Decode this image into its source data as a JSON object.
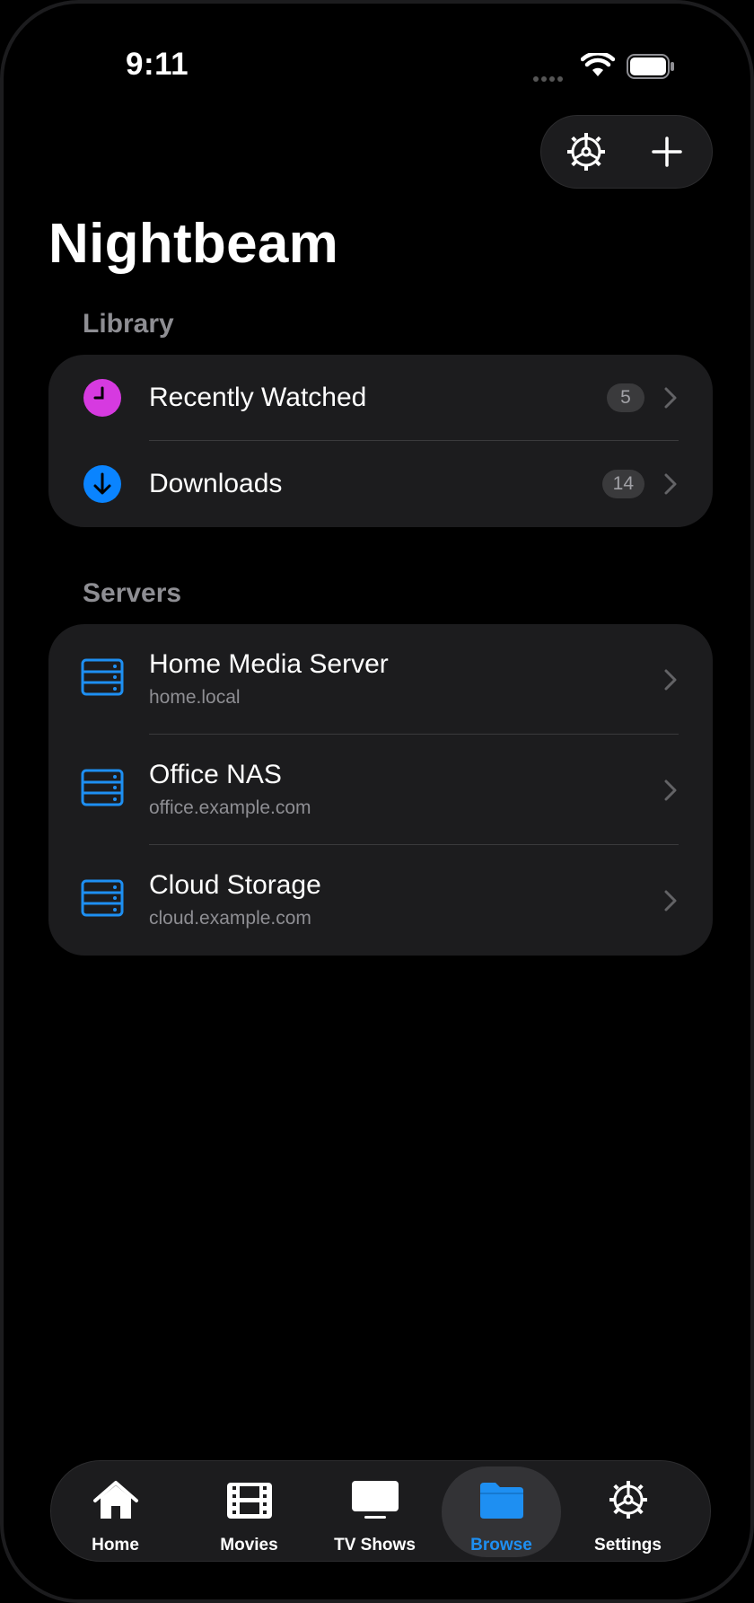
{
  "status_bar": {
    "time": "9:11"
  },
  "header": {
    "title": "Nightbeam"
  },
  "library": {
    "section_label": "Library",
    "items": [
      {
        "label": "Recently Watched",
        "badge": "5",
        "icon": "clock-icon",
        "icon_color": "#d63ae0"
      },
      {
        "label": "Downloads",
        "badge": "14",
        "icon": "download-arrow-icon",
        "icon_color": "#0a84ff"
      }
    ]
  },
  "servers": {
    "section_label": "Servers",
    "items": [
      {
        "name": "Home Media Server",
        "host": "home.local",
        "icon": "server-icon"
      },
      {
        "name": "Office NAS",
        "host": "office.example.com",
        "icon": "server-icon"
      },
      {
        "name": "Cloud Storage",
        "host": "cloud.example.com",
        "icon": "server-icon"
      }
    ]
  },
  "tabbar": {
    "active": "Browse",
    "items": [
      {
        "label": "Home",
        "icon": "house-icon"
      },
      {
        "label": "Movies",
        "icon": "film-icon"
      },
      {
        "label": "TV Shows",
        "icon": "tv-icon"
      },
      {
        "label": "Browse",
        "icon": "folder-icon"
      },
      {
        "label": "Settings",
        "icon": "gear-icon"
      }
    ]
  },
  "colors": {
    "accent": "#1e8ff2",
    "card": "#1c1c1e",
    "secondary_text": "#8e8e93"
  }
}
